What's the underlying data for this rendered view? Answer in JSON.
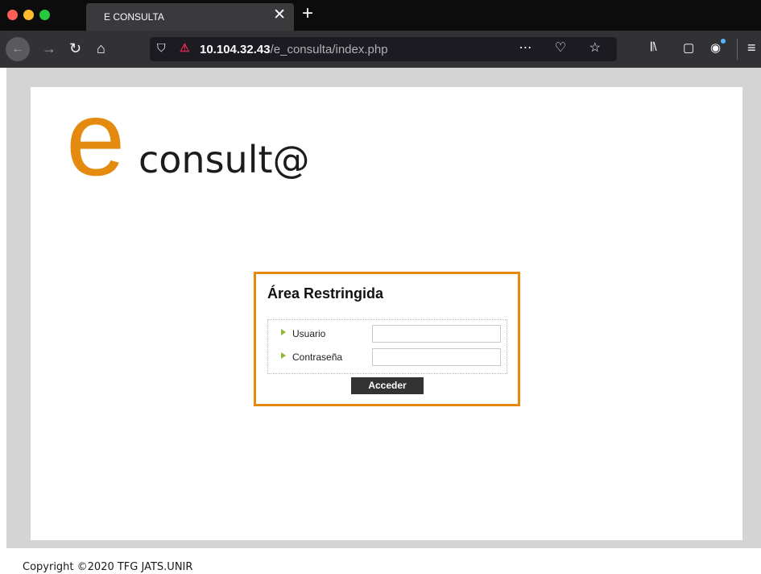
{
  "browser": {
    "tab_title": "E CONSULTA",
    "tab_close": "✕",
    "new_tab": "+",
    "url_host": "10.104.32.43",
    "url_path": "/e_consulta/index.php",
    "url_actions": "⋯ ♡ ☆",
    "back": "←",
    "forward": "→",
    "reload": "↻",
    "home": "⌂",
    "shield": "⛉",
    "insecure": "⚠",
    "library": "𝄃\\",
    "sidebar": "▢",
    "account": "◉",
    "menu": "≡"
  },
  "logo": {
    "letter": "e",
    "text": "consult@",
    "color": "#e48a0f"
  },
  "login": {
    "title": "Área Restringida",
    "user_label": "Usuario",
    "password_label": "Contraseña",
    "user_value": "",
    "password_value": "",
    "submit_label": "Acceder",
    "accent": "#e48a0f"
  },
  "footer": {
    "copyright": "Copyright ©2020 TFG JATS.UNIR"
  }
}
